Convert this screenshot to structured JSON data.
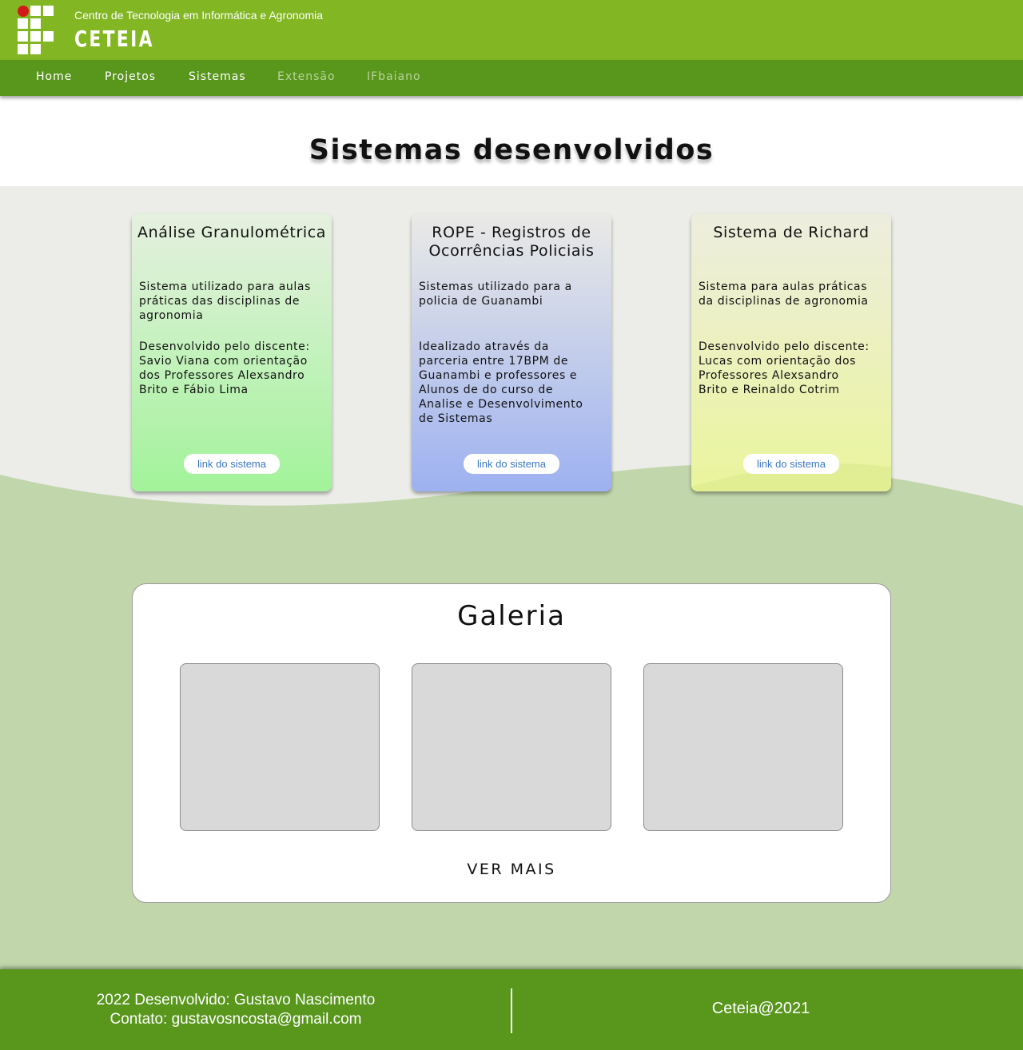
{
  "header": {
    "subtitle": "Centro de Tecnologia em Informática e Agronomia",
    "name": "CETEIA"
  },
  "nav": {
    "items": [
      {
        "label": "Home"
      },
      {
        "label": "Projetos"
      },
      {
        "label": "Sistemas"
      },
      {
        "label": "Extensão"
      },
      {
        "label": "IFbaiano"
      }
    ]
  },
  "main": {
    "title": "Sistemas desenvolvidos",
    "cards": [
      {
        "title": "Análise Granulométrica",
        "text1": "Sistema utilizado para aulas\npráticas das disciplinas de\nagronomia",
        "text2": "Desenvolvido pelo discente:\nSavio Viana com orientação\ndos Professores Alexsandro\nBrito e Fábio Lima",
        "link": "link do sistema",
        "color": "#a2f39a"
      },
      {
        "title": "ROPE - Registros de\nOcorrências Policiais",
        "text1": "Sistemas utilizado para a\npolicia de Guanambi",
        "text2": "Idealizado através da\nparceria entre 17BPM de\nGuanambi e professores e\nAlunos de do curso de\nAnalise e Desenvolvimento\nde Sistemas",
        "link": "link do sistema",
        "color": "#9db1f0"
      },
      {
        "title": "Sistema de Richard",
        "text1": "Sistema para aulas práticas\nda disciplinas de agronomia",
        "text2": "Desenvolvido pelo discente:\nLucas com orientação dos\nProfessores Alexsandro\nBrito e Reinaldo Cotrim",
        "link": "link do sistema",
        "color": "#eaf59b"
      }
    ]
  },
  "gallery": {
    "title": "Galeria",
    "more": "VER MAIS"
  },
  "footer": {
    "credit": "2022 Desenvolvido: Gustavo Nascimento",
    "contact": "Contato: gustavosncosta@gmail.com",
    "copyright": "Ceteia@2021"
  },
  "colors": {
    "header": "#82b623",
    "nav": "#58961c",
    "wave": "#c1d6ab",
    "band": "#ecede8"
  }
}
